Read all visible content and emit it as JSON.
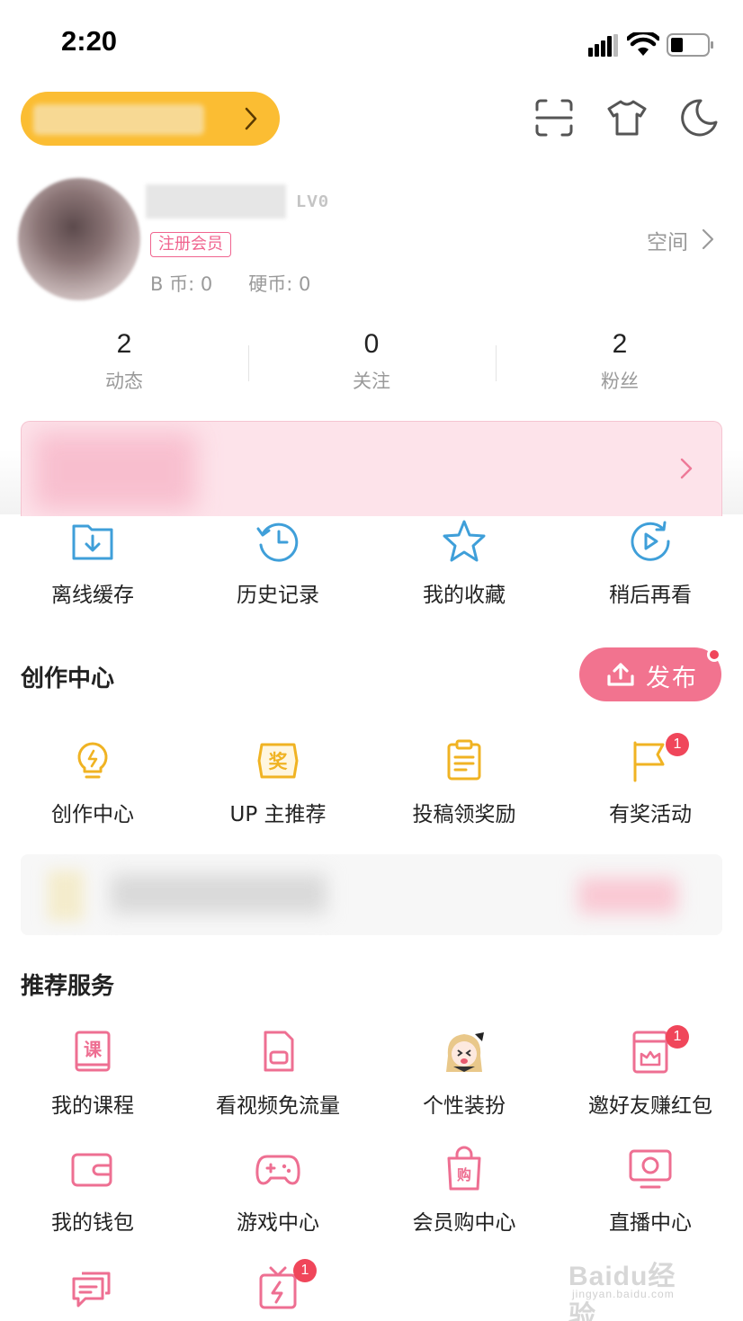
{
  "status_bar": {
    "time": "2:20"
  },
  "profile": {
    "level": "LV0",
    "member_tag": "注册会员",
    "b_coins": "B 币: 0",
    "hard_coins": "硬币: 0",
    "space_link": "空间"
  },
  "stats": [
    {
      "value": "2",
      "label": "动态"
    },
    {
      "value": "0",
      "label": "关注"
    },
    {
      "value": "2",
      "label": "粉丝"
    }
  ],
  "quick_actions": [
    {
      "label": "离线缓存",
      "icon": "download-folder-icon"
    },
    {
      "label": "历史记录",
      "icon": "history-clock-icon"
    },
    {
      "label": "我的收藏",
      "icon": "star-icon"
    },
    {
      "label": "稍后再看",
      "icon": "watch-later-icon"
    }
  ],
  "creation": {
    "title": "创作中心",
    "publish_label": "发布",
    "items": [
      {
        "label": "创作中心",
        "icon": "lightbulb-icon"
      },
      {
        "label": "UP 主推荐",
        "icon": "award-shield-icon"
      },
      {
        "label": "投稿领奖励",
        "icon": "clipboard-icon"
      },
      {
        "label": "有奖活动",
        "icon": "flag-icon",
        "badge": "1"
      }
    ]
  },
  "services": {
    "title": "推荐服务",
    "items": [
      {
        "label": "我的课程",
        "icon": "course-book-icon",
        "course_char": "课"
      },
      {
        "label": "看视频免流量",
        "icon": "sim-card-icon"
      },
      {
        "label": "个性装扮",
        "icon": "anime-avatar-icon"
      },
      {
        "label": "邀好友赚红包",
        "icon": "red-envelope-icon",
        "badge": "1"
      },
      {
        "label": "我的钱包",
        "icon": "wallet-icon"
      },
      {
        "label": "游戏中心",
        "icon": "gamepad-icon"
      },
      {
        "label": "会员购中心",
        "icon": "shopping-bag-icon",
        "bag_char": "购"
      },
      {
        "label": "直播中心",
        "icon": "live-tv-icon"
      },
      {
        "label": "",
        "icon": "chat-bubbles-icon"
      },
      {
        "label": "",
        "icon": "gift-box-icon",
        "badge": "1"
      }
    ]
  },
  "watermark": {
    "main": "Baidu经验",
    "sub": "jingyan.baidu.com"
  },
  "colors": {
    "accent_pink": "#f2738f",
    "vip_yellow": "#fbbd33",
    "icon_blue": "#3f9fd9",
    "icon_yellow": "#f0b323",
    "badge_red": "#f0465a"
  }
}
